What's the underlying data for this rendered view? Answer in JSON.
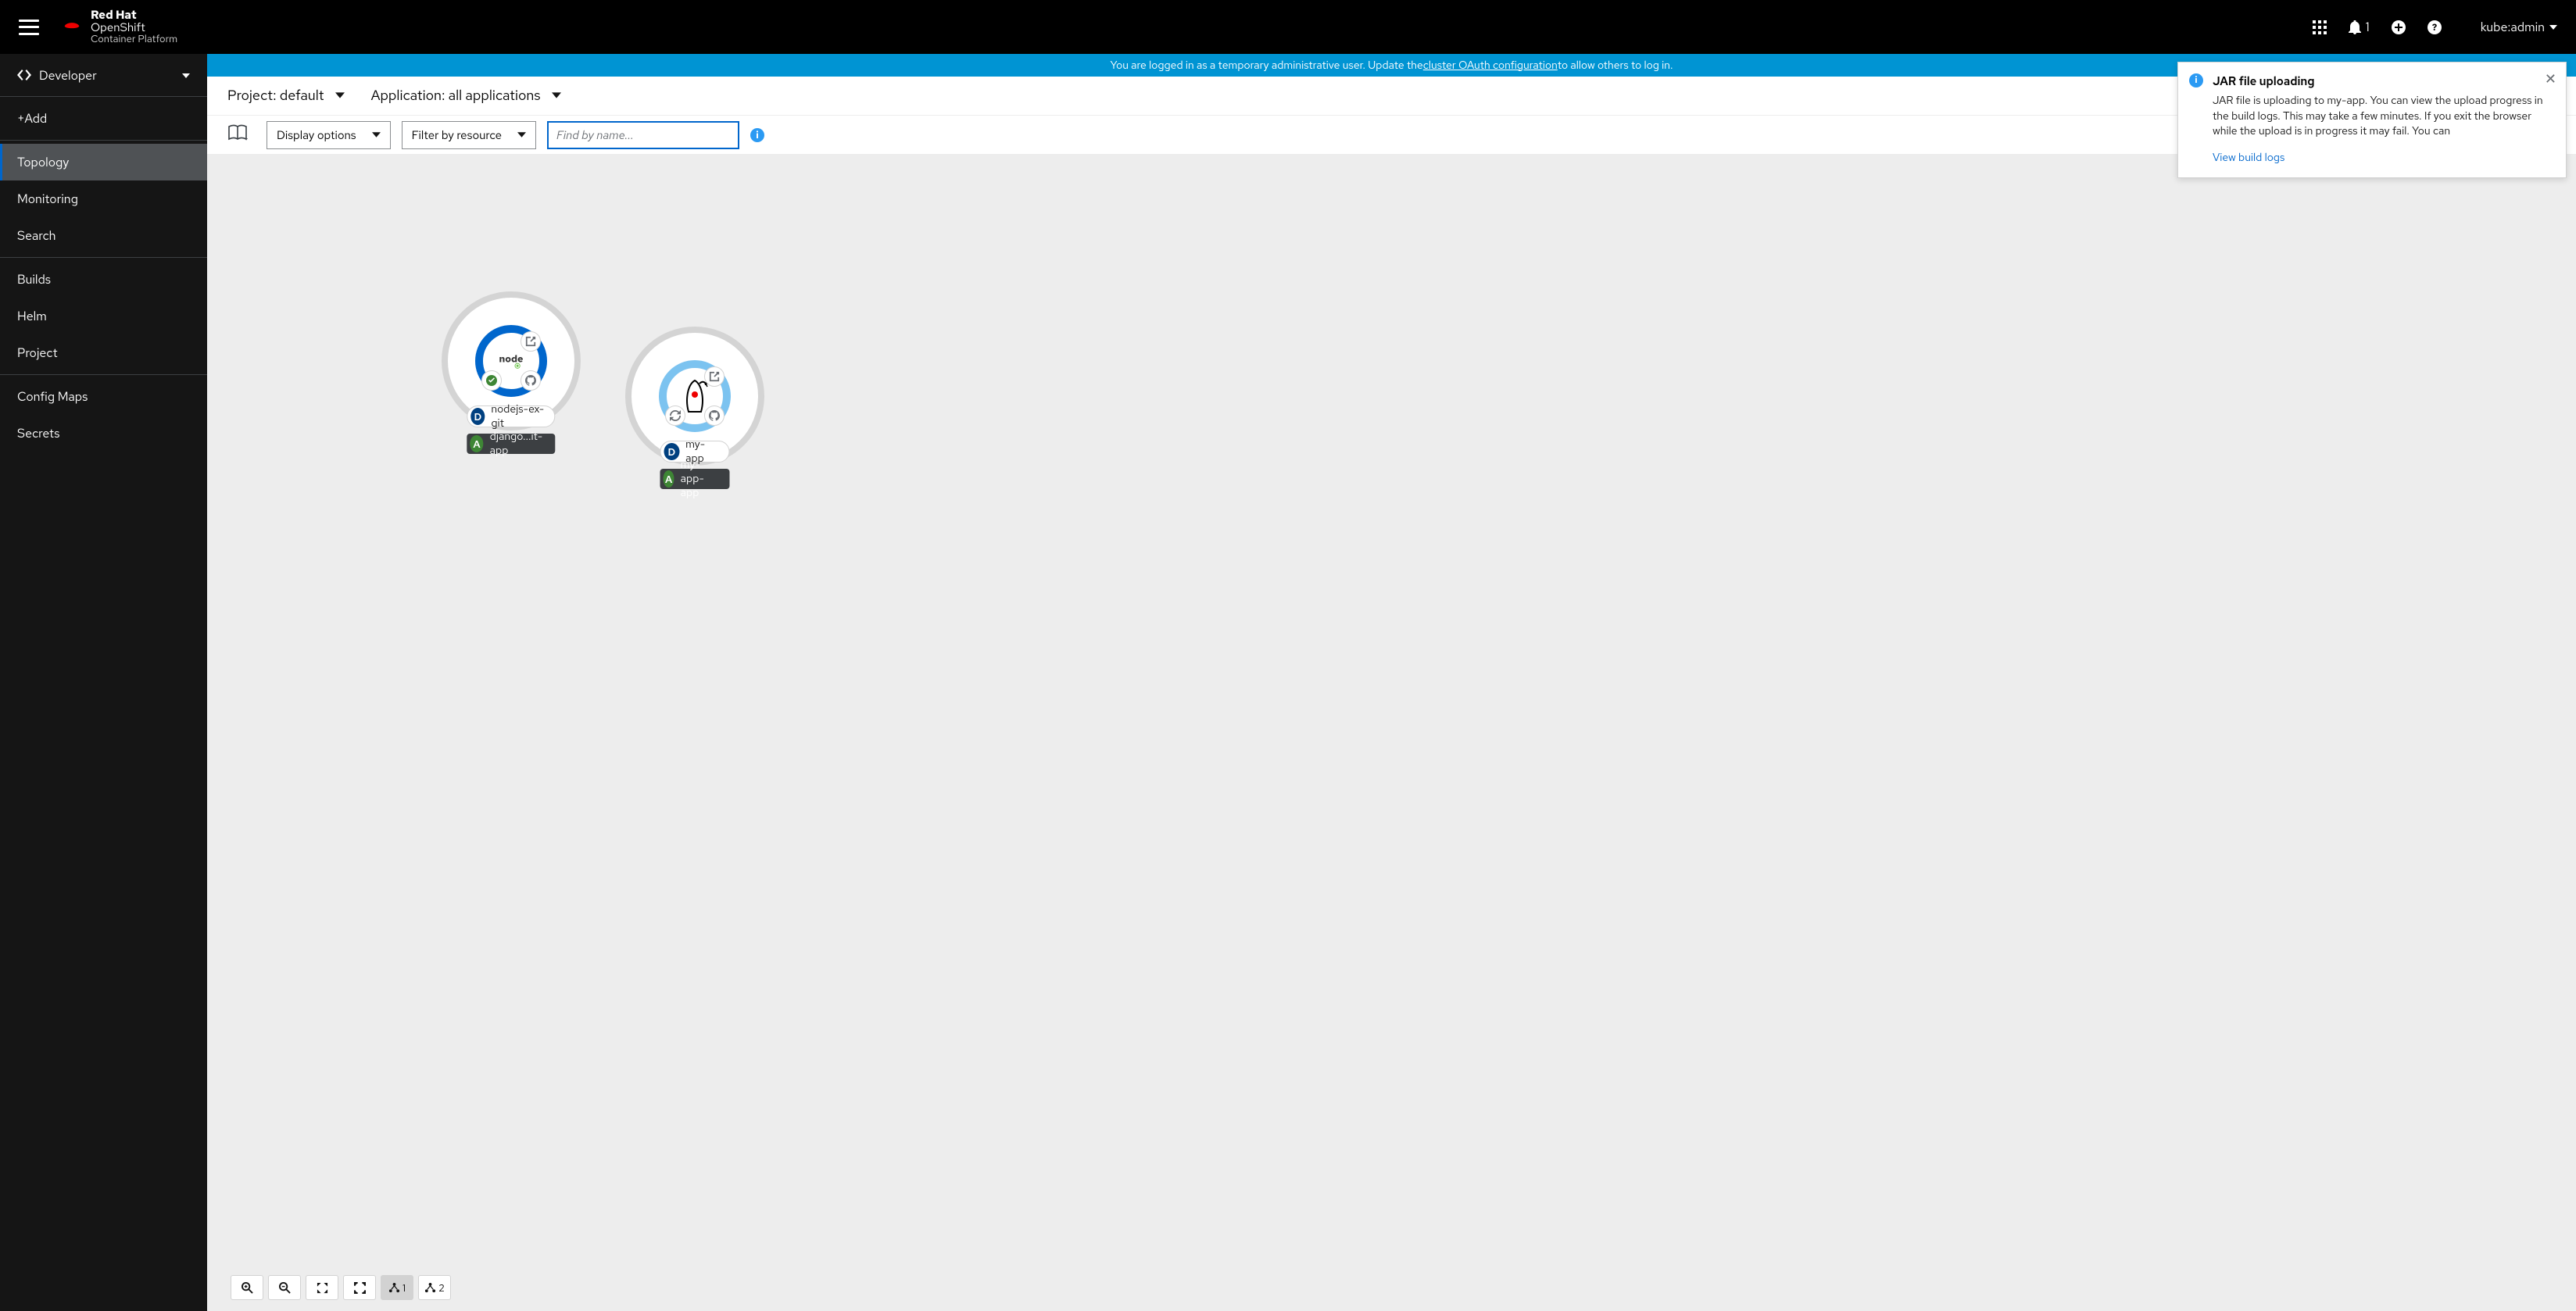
{
  "brand": {
    "line1_bold": "Red Hat",
    "line1_reg": "",
    "line2": "OpenShift",
    "line3": "Container Platform"
  },
  "header": {
    "notif_count": "1",
    "user": "kube:admin"
  },
  "perspective": {
    "label": "Developer"
  },
  "nav": {
    "add": "+Add",
    "topology": "Topology",
    "monitoring": "Monitoring",
    "search": "Search",
    "builds": "Builds",
    "helm": "Helm",
    "project": "Project",
    "configmaps": "Config Maps",
    "secrets": "Secrets"
  },
  "banner": {
    "pre": "You are logged in as a temporary administrative user. Update the ",
    "link": "cluster OAuth configuration",
    "post": " to allow others to log in."
  },
  "context": {
    "project_label": "Project: default",
    "app_label": "Application: all applications"
  },
  "toolbar": {
    "display": "Display options",
    "filter": "Filter by resource",
    "name_placeholder": "Find by name..."
  },
  "toast": {
    "title": "JAR file uploading",
    "body": "JAR file is uploading to my-app. You can view the upload progress in the build logs. This may take a few minutes. If you exit the browser while the upload is in progress it may fail. You can",
    "link": "View build logs"
  },
  "nodes": {
    "a": {
      "name": "nodejs-ex-git",
      "app": "django...it-app",
      "logo": "node"
    },
    "b": {
      "name": "my-app",
      "app": "my-app-app",
      "logo": "java"
    }
  },
  "bottom": {
    "c5": "1",
    "c6": "2"
  }
}
